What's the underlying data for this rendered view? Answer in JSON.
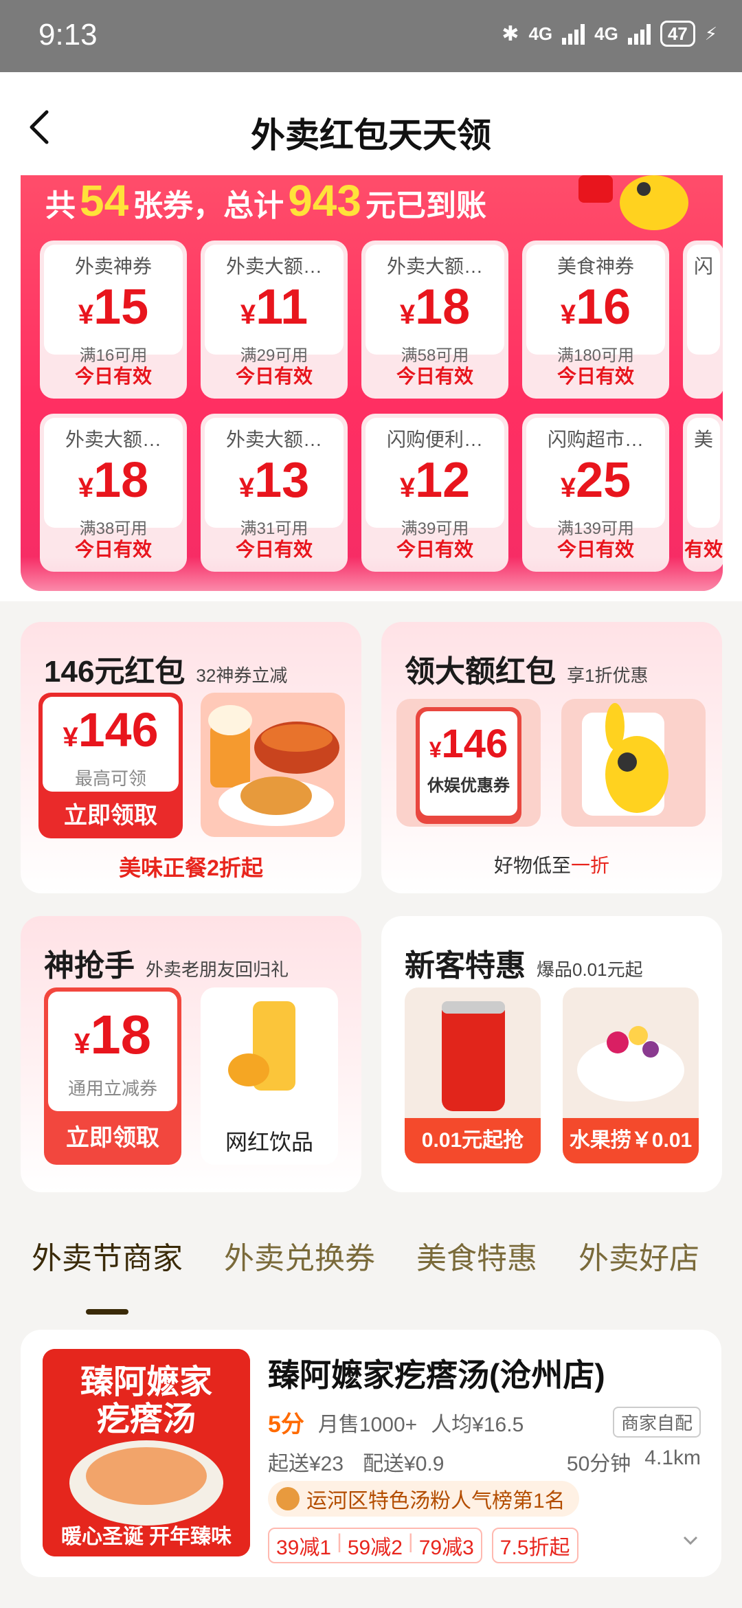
{
  "status": {
    "time": "9:13",
    "net1": "4G",
    "net2": "4G",
    "battery": "47"
  },
  "nav": {
    "title": "外卖红包天天领"
  },
  "summary": {
    "pre": "共",
    "count": "54",
    "mid": "张券，总计",
    "total": "943",
    "post": "元已到账"
  },
  "coupon_rows": [
    [
      {
        "name": "外卖神券",
        "amount": "15",
        "cond": "满16可用",
        "valid": "今日有效"
      },
      {
        "name": "外卖大额…",
        "amount": "11",
        "cond": "满29可用",
        "valid": "今日有效"
      },
      {
        "name": "外卖大额…",
        "amount": "18",
        "cond": "满58可用",
        "valid": "今日有效"
      },
      {
        "name": "美食神券",
        "amount": "16",
        "cond": "满180可用",
        "valid": "今日有效"
      },
      {
        "name": "闪",
        "amount": "",
        "cond": "",
        "valid": ""
      }
    ],
    [
      {
        "name": "外卖大额…",
        "amount": "18",
        "cond": "满38可用",
        "valid": "今日有效"
      },
      {
        "name": "外卖大额…",
        "amount": "13",
        "cond": "满31可用",
        "valid": "今日有效"
      },
      {
        "name": "闪购便利…",
        "amount": "12",
        "cond": "满39可用",
        "valid": "今日有效"
      },
      {
        "name": "闪购超市…",
        "amount": "25",
        "cond": "满139可用",
        "valid": "今日有效"
      },
      {
        "name": "美",
        "amount": "",
        "cond": "",
        "valid": "有效"
      }
    ]
  ],
  "currency": "¥",
  "card1": {
    "title": "146元红包",
    "sub": "32神券立减",
    "amount": "146",
    "amount_sub": "最高可领",
    "button": "立即领取",
    "footer": "美味正餐2折起"
  },
  "card2": {
    "title": "领大额红包",
    "sub": "享1折优惠",
    "amount": "146",
    "amount_sub": "休娱优惠券",
    "footer_pre": "好物低至",
    "footer_hl": "一折"
  },
  "card3": {
    "title": "神抢手",
    "sub": "外卖老朋友回归礼",
    "amount": "18",
    "amount_sub": "通用立减券",
    "button": "立即领取",
    "item": "网红饮品"
  },
  "card4": {
    "title": "新客特惠",
    "sub": "爆品0.01元起",
    "item1": "0.01元起抢",
    "item2": "水果捞￥0.01"
  },
  "tabs": [
    "外卖节商家",
    "外卖兑换券",
    "美食特惠",
    "外卖好店"
  ],
  "store": {
    "name": "臻阿嬷家疙瘩汤(沧州店)",
    "score": "5分",
    "monthly": "月售1000+",
    "avg": "人均¥16.5",
    "delivery_tag": "商家自配",
    "min_order": "起送¥23",
    "delivery_fee": "配送¥0.9",
    "time": "50分钟",
    "distance": "4.1km",
    "rank": "运河区特色汤粉人气榜第1名",
    "promos": [
      "39减1",
      "59减2",
      "79减3"
    ],
    "discount": "7.5折起",
    "pic_title1": "臻阿嬷家",
    "pic_title2": "疙瘩汤",
    "pic_slogan": "暖心圣诞 开年臻味"
  },
  "colors": {
    "accent": "#e8151d",
    "hero": "#ff3a63",
    "tab_active": "#3a2a08"
  }
}
